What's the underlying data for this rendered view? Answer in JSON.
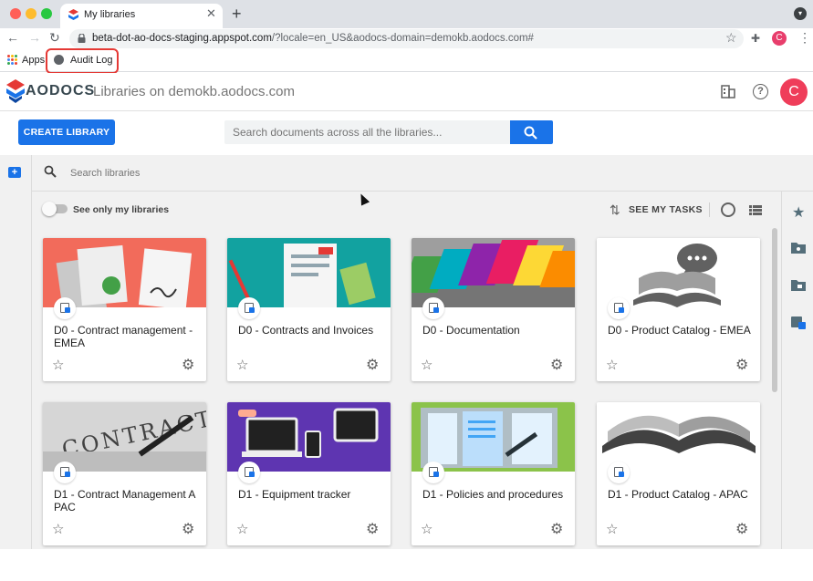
{
  "browser": {
    "tab_title": "My libraries",
    "tab_close": "✕",
    "new_tab": "+",
    "url_host": "beta-dot-ao-docs-staging.appspot.com",
    "url_path": "/?locale=en_US&aodocs-domain=demokb.aodocs.com#",
    "profile_initial": "C",
    "bookmarks": [
      {
        "label": "Apps"
      },
      {
        "label": "Audit Log"
      }
    ],
    "traffic_colors": [
      "#ff5f57",
      "#febc2e",
      "#28c840"
    ]
  },
  "app": {
    "logo_text": "AODOCS",
    "title": "Libraries on demokb.aodocs.com",
    "avatar_initial": "C",
    "create_button": "CREATE LIBRARY",
    "global_search_placeholder": "Search documents across all the libraries...",
    "library_search_placeholder": "Search libraries",
    "toggle_label": "See only my libraries",
    "tasks_label": "SEE MY TASKS",
    "accent_color": "#1a73e8",
    "avatar_color": "#ef3d5a"
  },
  "libraries": [
    {
      "name": "D0 - Contract management - EMEA",
      "thumb": "contracts-red"
    },
    {
      "name": "D0 - Contracts and Invoices",
      "thumb": "invoices-teal"
    },
    {
      "name": "D0 - Documentation",
      "thumb": "folders-rainbow"
    },
    {
      "name": "D0 - Product Catalog - EMEA",
      "thumb": "book-speech"
    },
    {
      "name": "D1 - Contract Management A PAC",
      "thumb": "contract-paper"
    },
    {
      "name": "D1 - Equipment tracker",
      "thumb": "devices-purple"
    },
    {
      "name": "D1 - Policies and procedures",
      "thumb": "docs-green"
    },
    {
      "name": "D1 - Product Catalog - APAC",
      "thumb": "open-book"
    }
  ],
  "icons": {
    "star": "☆",
    "settings": "⚙"
  }
}
